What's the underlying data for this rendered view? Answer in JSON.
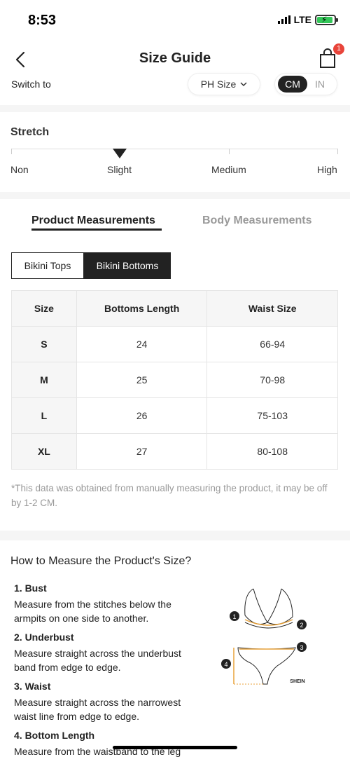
{
  "status": {
    "time": "8:53",
    "network": "LTE"
  },
  "nav": {
    "title": "Size Guide",
    "cart_count": "1"
  },
  "switch": {
    "label": "Switch to",
    "size_system": "PH Size",
    "unit_active": "CM",
    "unit_inactive": "IN"
  },
  "stretch": {
    "title": "Stretch",
    "levels": [
      "Non",
      "Slight",
      "Medium",
      "High"
    ],
    "selected": "Slight"
  },
  "tabs": {
    "active": "Product Measurements",
    "inactive": "Body Measurements"
  },
  "segments": {
    "tops": "Bikini Tops",
    "bottoms": "Bikini Bottoms",
    "selected": "Bikini Bottoms"
  },
  "table": {
    "headers": [
      "Size",
      "Bottoms Length",
      "Waist Size"
    ],
    "rows": [
      [
        "S",
        "24",
        "66-94"
      ],
      [
        "M",
        "25",
        "70-98"
      ],
      [
        "L",
        "26",
        "75-103"
      ],
      [
        "XL",
        "27",
        "80-108"
      ]
    ]
  },
  "note": "*This data was obtained from manually measuring the product, it may be off by 1-2 CM.",
  "how_to": {
    "title": "How to Measure the Product's Size?",
    "items": [
      {
        "head": "1. Bust",
        "desc": "Measure from the stitches below the armpits on one side to another."
      },
      {
        "head": "2. Underbust",
        "desc": "Measure straight across the underbust band from edge to edge."
      },
      {
        "head": "3. Waist",
        "desc": "Measure straight across the narrowest waist line from edge to edge."
      },
      {
        "head": "4. Bottom Length",
        "desc": "Measure from the waistband to the leg"
      }
    ],
    "diagram_brand": "SHEIN",
    "diagram_numbers": [
      "1",
      "2",
      "3",
      "4"
    ]
  },
  "colors": {
    "accent": "#222222",
    "badge": "#e8443a",
    "measure_line": "#e8a23a",
    "battery": "#34c759"
  }
}
